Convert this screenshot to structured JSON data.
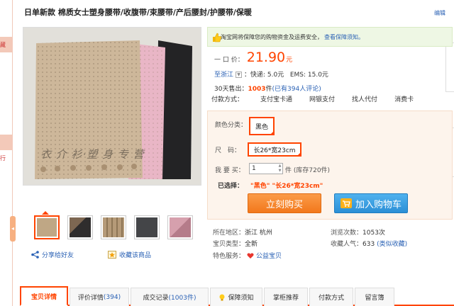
{
  "title": "日单新款 棉质女士塑身腰带/收腹带/束腰带/产后腰封/护腰带/保暖",
  "edit_label": "编辑",
  "left_edge": [
    "藏",
    "行"
  ],
  "image": {
    "watermark": "衣 介 衫·塑 身 专 营",
    "swatch_colors": [
      "#cdb79a",
      "#e9b6c6",
      "#232325"
    ]
  },
  "thumbnails": [
    {
      "name": "thumb-beige",
      "color": "#bfa785"
    },
    {
      "name": "thumb-dark",
      "color": "#3c3a3a"
    },
    {
      "name": "thumb-beige-detail",
      "color": "#b59a78"
    },
    {
      "name": "thumb-black",
      "color": "#444548"
    },
    {
      "name": "thumb-pink",
      "color": "#d6a0ad"
    }
  ],
  "share_label": "分享给好友",
  "fav_label": "收藏该商品",
  "notice": {
    "text": "淘宝网将保障您的购物资金及运费安全，",
    "link": "查看保障须知。"
  },
  "price": {
    "label": "一 口 价：",
    "value": "21.90",
    "unit": "元"
  },
  "shipping": {
    "dest": "至浙江",
    "express": "：快递: 5.0元",
    "ems": "EMS: 15.0元"
  },
  "sales": {
    "label": "30天售出：",
    "count": "1003",
    "unit": "件",
    "reviews": "(已有394人评论)"
  },
  "payment": {
    "label": "付款方式：",
    "options": [
      "支付宝卡通",
      "网银支付",
      "找人代付",
      "消费卡"
    ]
  },
  "sku": {
    "color_label": "颜色分类：",
    "color_value": "黑色",
    "size_label": "尺　码：",
    "size_value": "长26*宽23cm",
    "qty_label": "我 要 买：",
    "qty_value": "1",
    "stock": "件 (库存720件)",
    "chosen_label": "已选择：",
    "chosen_value": "\"黑色\" \"长26*宽23cm\""
  },
  "buttons": {
    "buy": "立刻购买",
    "cart": "加入购物车"
  },
  "meta": {
    "location_label": "所在地区：",
    "location": "浙江 杭州",
    "views_label": "浏览次数：",
    "views": "1053次",
    "type_label": "宝贝类型：",
    "type": "全新",
    "popularity_label": "收藏人气：",
    "popularity": "633",
    "popularity_link": "(类似收藏)",
    "service_label": "特色服务：",
    "service": "公益宝贝"
  },
  "tabs": [
    {
      "label": "宝贝详情",
      "count": ""
    },
    {
      "label": "评价详情",
      "count": "(394)"
    },
    {
      "label": "成交记录",
      "count": "(1003件)"
    },
    {
      "label": "保障须知",
      "count": ""
    },
    {
      "label": "掌柜推荐",
      "count": ""
    },
    {
      "label": "付款方式",
      "count": ""
    },
    {
      "label": "留言簿",
      "count": ""
    }
  ]
}
